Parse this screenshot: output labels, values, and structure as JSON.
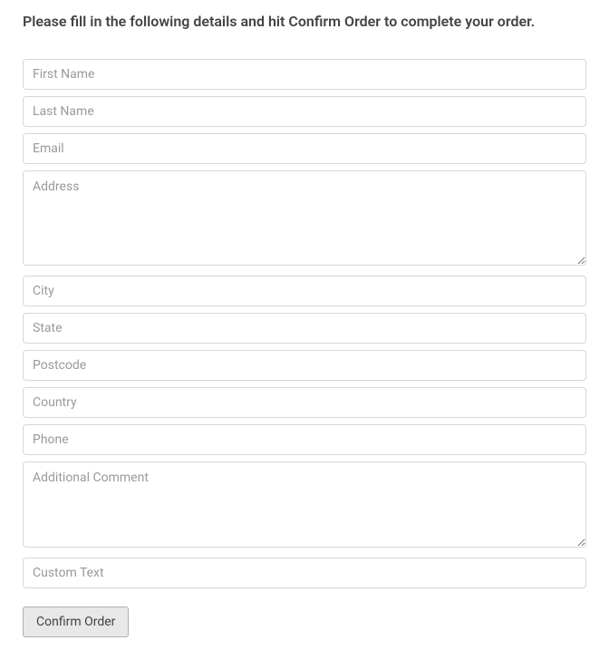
{
  "instruction": "Please fill in the following details and hit Confirm Order to complete your order.",
  "fields": {
    "first_name": {
      "placeholder": "First Name",
      "value": ""
    },
    "last_name": {
      "placeholder": "Last Name",
      "value": ""
    },
    "email": {
      "placeholder": "Email",
      "value": ""
    },
    "address": {
      "placeholder": "Address",
      "value": ""
    },
    "city": {
      "placeholder": "City",
      "value": ""
    },
    "state": {
      "placeholder": "State",
      "value": ""
    },
    "postcode": {
      "placeholder": "Postcode",
      "value": ""
    },
    "country": {
      "placeholder": "Country",
      "value": ""
    },
    "phone": {
      "placeholder": "Phone",
      "value": ""
    },
    "additional_comment": {
      "placeholder": "Additional Comment",
      "value": ""
    },
    "custom_text": {
      "placeholder": "Custom Text",
      "value": ""
    }
  },
  "submit_label": "Confirm Order"
}
